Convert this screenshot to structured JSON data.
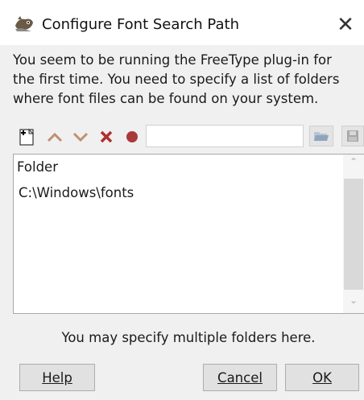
{
  "window": {
    "title": "Configure Font Search Path",
    "close_symbol": "✕"
  },
  "intro": {
    "lines": [
      "You seem to be running the FreeType plug-in for",
      "the first time. You need to specify a list of folders",
      "where font files can be found on your system."
    ]
  },
  "toolbar": {
    "icons": [
      "new-folder-icon",
      "move-up-icon",
      "move-down-icon",
      "delete-icon",
      "record-icon",
      "open-folder-icon",
      "save-icon"
    ],
    "path_value": ""
  },
  "list": {
    "header": "Folder",
    "rows": [
      "C:\\Windows\\fonts"
    ]
  },
  "hint": "You may specify multiple folders here.",
  "buttons": {
    "help": "Help",
    "cancel": "Cancel",
    "ok": "OK"
  },
  "colors": {
    "arrow": "#c09070",
    "delete": "#b03030",
    "record": "#a83a3a",
    "window_bg": "#f0f0f0"
  }
}
